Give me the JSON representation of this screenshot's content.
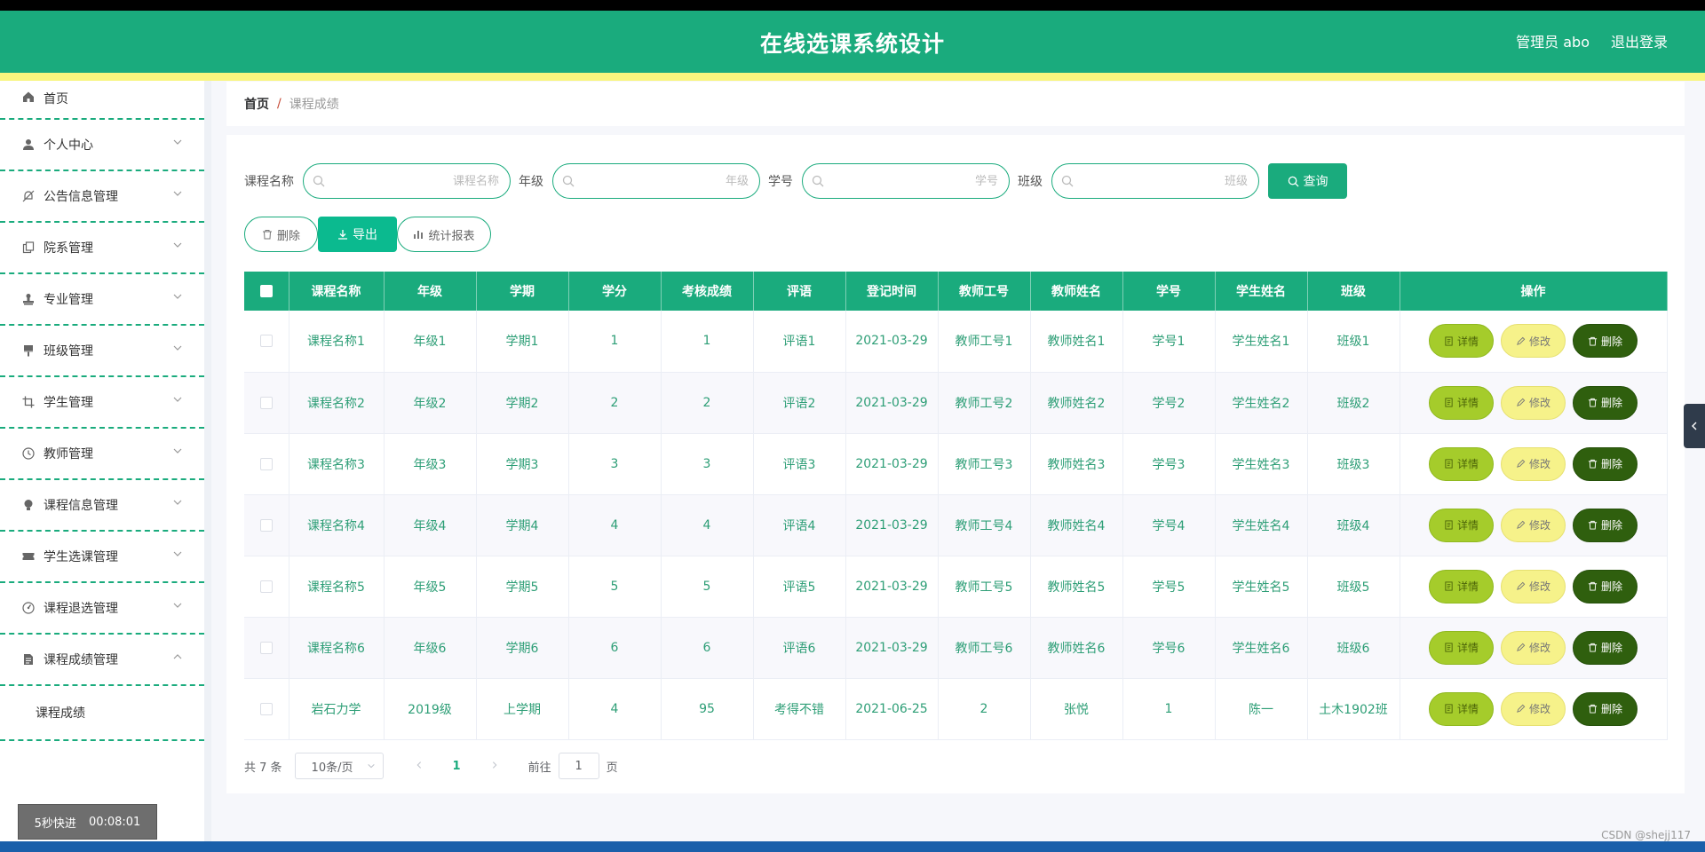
{
  "header": {
    "title": "在线选课系统设计",
    "user": "管理员 abo",
    "logout": "退出登录"
  },
  "sidebar": {
    "items": [
      {
        "label": "首页",
        "icon": "home-icon"
      },
      {
        "label": "个人中心",
        "icon": "user-icon"
      },
      {
        "label": "公告信息管理",
        "icon": "bell-off-icon"
      },
      {
        "label": "院系管理",
        "icon": "copy-icon"
      },
      {
        "label": "专业管理",
        "icon": "stamp-icon"
      },
      {
        "label": "班级管理",
        "icon": "brush-icon"
      },
      {
        "label": "学生管理",
        "icon": "crop-icon"
      },
      {
        "label": "教师管理",
        "icon": "clock-icon"
      },
      {
        "label": "课程信息管理",
        "icon": "lightbulb-icon"
      },
      {
        "label": "学生选课管理",
        "icon": "ticket-icon"
      },
      {
        "label": "课程退选管理",
        "icon": "gauge-icon"
      },
      {
        "label": "课程成绩管理",
        "icon": "document-icon"
      }
    ],
    "sub_item": "课程成绩",
    "timer": {
      "label": "5秒快进",
      "time": "00:08:01"
    }
  },
  "breadcrumb": {
    "home": "首页",
    "sep": "/",
    "current": "课程成绩"
  },
  "search": {
    "fields": [
      {
        "label": "课程名称",
        "placeholder": "课程名称"
      },
      {
        "label": "年级",
        "placeholder": "年级"
      },
      {
        "label": "学号",
        "placeholder": "学号"
      },
      {
        "label": "班级",
        "placeholder": "班级"
      }
    ],
    "query_label": "查询"
  },
  "actions": {
    "delete": "删除",
    "export": "导出",
    "report": "统计报表"
  },
  "table": {
    "columns": [
      "课程名称",
      "年级",
      "学期",
      "学分",
      "考核成绩",
      "评语",
      "登记时间",
      "教师工号",
      "教师姓名",
      "学号",
      "学生姓名",
      "班级",
      "操作"
    ],
    "rows": [
      [
        "课程名称1",
        "年级1",
        "学期1",
        "1",
        "1",
        "评语1",
        "2021-03-29",
        "教师工号1",
        "教师姓名1",
        "学号1",
        "学生姓名1",
        "班级1"
      ],
      [
        "课程名称2",
        "年级2",
        "学期2",
        "2",
        "2",
        "评语2",
        "2021-03-29",
        "教师工号2",
        "教师姓名2",
        "学号2",
        "学生姓名2",
        "班级2"
      ],
      [
        "课程名称3",
        "年级3",
        "学期3",
        "3",
        "3",
        "评语3",
        "2021-03-29",
        "教师工号3",
        "教师姓名3",
        "学号3",
        "学生姓名3",
        "班级3"
      ],
      [
        "课程名称4",
        "年级4",
        "学期4",
        "4",
        "4",
        "评语4",
        "2021-03-29",
        "教师工号4",
        "教师姓名4",
        "学号4",
        "学生姓名4",
        "班级4"
      ],
      [
        "课程名称5",
        "年级5",
        "学期5",
        "5",
        "5",
        "评语5",
        "2021-03-29",
        "教师工号5",
        "教师姓名5",
        "学号5",
        "学生姓名5",
        "班级5"
      ],
      [
        "课程名称6",
        "年级6",
        "学期6",
        "6",
        "6",
        "评语6",
        "2021-03-29",
        "教师工号6",
        "教师姓名6",
        "学号6",
        "学生姓名6",
        "班级6"
      ],
      [
        "岩石力学",
        "2019级",
        "上学期",
        "4",
        "95",
        "考得不错",
        "2021-06-25",
        "2",
        "张悦",
        "1",
        "陈一",
        "土木1902班"
      ]
    ],
    "ops": {
      "detail": "详情",
      "edit": "修改",
      "delete": "删除"
    }
  },
  "pagination": {
    "total": "共 7 条",
    "page_size": "10条/页",
    "current": "1",
    "goto_prefix": "前往",
    "goto_value": "1",
    "goto_suffix": "页"
  },
  "watermark": "CSDN @shejj117",
  "colors": {
    "primary": "#1aab7d",
    "stripe": "#f8f57e",
    "detail": "#a5cc2b",
    "edit": "#f6f28a",
    "delete": "#2f5f0e"
  }
}
